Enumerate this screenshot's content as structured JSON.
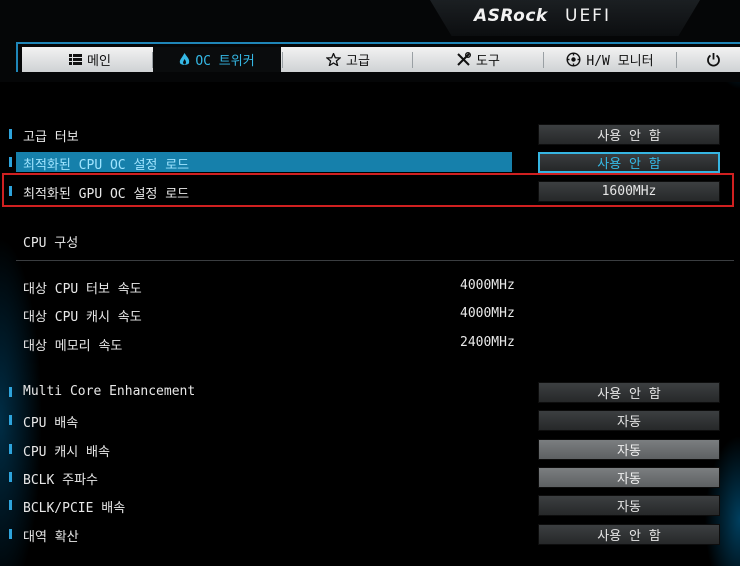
{
  "brand": {
    "name": "ASRock",
    "product": "UEFI"
  },
  "tabs": [
    {
      "label": "메인",
      "icon": "list-icon"
    },
    {
      "label": "OC 트위커",
      "icon": "flame-icon",
      "active": true
    },
    {
      "label": "고급",
      "icon": "star-icon"
    },
    {
      "label": "도구",
      "icon": "tools-icon"
    },
    {
      "label": "H/W 모니터",
      "icon": "monitor-icon"
    },
    {
      "label": "",
      "icon": "power-icon"
    }
  ],
  "settings_top": [
    {
      "label": "고급 터보",
      "value": "사용 안 함"
    },
    {
      "label": "최적화된 CPU OC 설정 로드",
      "value": "사용 안 함",
      "selected": true
    },
    {
      "label": "최적화된 GPU OC 설정 로드",
      "value": "1600MHz",
      "highlighted": true
    }
  ],
  "cpu_section": {
    "title": "CPU 구성",
    "info": [
      {
        "label": "대상 CPU 터보 속도",
        "value": "4000MHz"
      },
      {
        "label": "대상 CPU 캐시 속도",
        "value": "4000MHz"
      },
      {
        "label": "대상 메모리 속도",
        "value": "2400MHz"
      }
    ]
  },
  "settings_bottom": [
    {
      "label": "Multi Core Enhancement",
      "value": "사용 안 함"
    },
    {
      "label": "CPU 배속",
      "value": "자동"
    },
    {
      "label": "CPU 캐시 배속",
      "value": "자동",
      "disabled": true
    },
    {
      "label": "BCLK 주파수",
      "value": "자동",
      "disabled": true
    },
    {
      "label": "BCLK/PCIE 배속",
      "value": "자동"
    },
    {
      "label": "대역 확산",
      "value": "사용 안 함"
    }
  ],
  "colors": {
    "accent": "#35b9e6",
    "selection": "#1680ab",
    "highlight_frame": "#d02020"
  }
}
